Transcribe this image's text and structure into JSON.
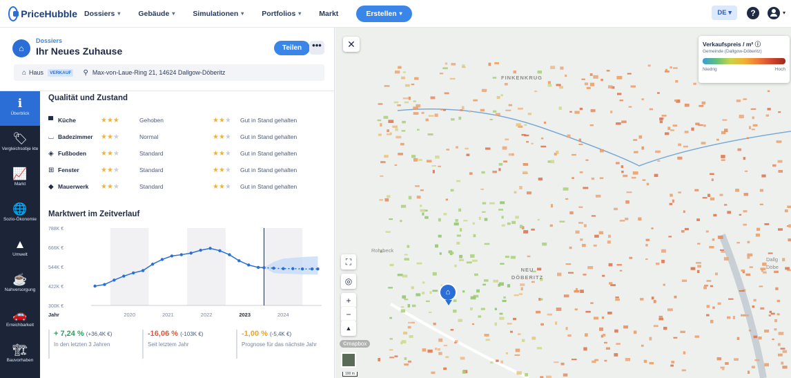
{
  "topbar": {
    "logo": "PriceHubble",
    "nav": [
      {
        "label": "Dossiers",
        "caret": true
      },
      {
        "label": "Gebäude",
        "caret": true
      },
      {
        "label": "Simulationen",
        "caret": true
      },
      {
        "label": "Portfolios",
        "caret": true
      },
      {
        "label": "Markt",
        "caret": false
      }
    ],
    "create_label": "Erstellen",
    "language": "DE",
    "help": "?"
  },
  "header": {
    "breadcrumb": "Dossiers",
    "title": "Ihr Neues Zuhause",
    "share_label": "Teilen",
    "more_label": "•••",
    "property_type": "Haus",
    "tag": "VERKAUF",
    "address": "Max-von-Laue-Ring 21, 14624 Dallgow-Döberitz"
  },
  "sidebar": {
    "items": [
      {
        "label": "Überblick",
        "icon": "info-icon",
        "glyph": "ℹ",
        "active": true
      },
      {
        "label": "Vergleichsobje kte",
        "icon": "tag-icon",
        "glyph": "🏷",
        "active": false
      },
      {
        "label": "Markt",
        "icon": "market-chart-icon",
        "glyph": "📈",
        "active": false
      },
      {
        "label": "Sozio-Ökonomie",
        "icon": "globe-icon",
        "glyph": "🌐",
        "active": false
      },
      {
        "label": "Umwelt",
        "icon": "mountain-icon",
        "glyph": "▲",
        "active": false
      },
      {
        "label": "Nahversorgung",
        "icon": "cup-icon",
        "glyph": "☕",
        "active": false
      },
      {
        "label": "Erreichbarkeit",
        "icon": "car-icon",
        "glyph": "🚗",
        "active": false
      },
      {
        "label": "Bauvorhaben",
        "icon": "crane-icon",
        "glyph": "🏗",
        "active": false
      }
    ]
  },
  "quality": {
    "title": "Qualität und Zustand",
    "rows": [
      {
        "name": "Küche",
        "icon": "kitchen-icon",
        "glyph": "▀",
        "rating": 3,
        "value": "Gehoben",
        "cond_rating": 2,
        "condition": "Gut in Stand gehalten"
      },
      {
        "name": "Badezimmer",
        "icon": "bathtub-icon",
        "glyph": "⌴",
        "rating": 2,
        "value": "Normal",
        "cond_rating": 2,
        "condition": "Gut in Stand gehalten"
      },
      {
        "name": "Fußboden",
        "icon": "floor-icon",
        "glyph": "◈",
        "rating": 2,
        "value": "Standard",
        "cond_rating": 2,
        "condition": "Gut in Stand gehalten"
      },
      {
        "name": "Fenster",
        "icon": "window-icon",
        "glyph": "⊞",
        "rating": 2,
        "value": "Standard",
        "cond_rating": 2,
        "condition": "Gut in Stand gehalten"
      },
      {
        "name": "Mauerwerk",
        "icon": "wall-icon",
        "glyph": "◆",
        "rating": 2,
        "value": "Standard",
        "cond_rating": 2,
        "condition": "Gut in Stand gehalten"
      }
    ]
  },
  "market_value": {
    "title": "Marktwert im Zeitverlauf"
  },
  "chart_data": {
    "type": "line",
    "title": "Marktwert im Zeitverlauf",
    "xlabel": "Jahr",
    "ylabel": "",
    "x_ticks": [
      "2020",
      "2021",
      "2022",
      "2023",
      "2024"
    ],
    "y_ticks": [
      "788K €",
      "666K €",
      "544K €",
      "422K €",
      "300K €"
    ],
    "ylim": [
      300,
      788
    ],
    "xlim": [
      2019.0,
      2025.0
    ],
    "series": [
      {
        "kind": "historical",
        "x": [
          2019.1,
          2019.35,
          2019.6,
          2019.85,
          2020.1,
          2020.35,
          2020.6,
          2020.85,
          2021.1,
          2021.35,
          2021.6,
          2021.85,
          2022.1,
          2022.35,
          2022.6,
          2022.85,
          2023.1,
          2023.35,
          2023.5
        ],
        "values": [
          422,
          432,
          460,
          485,
          505,
          520,
          560,
          590,
          612,
          620,
          630,
          648,
          660,
          645,
          620,
          582,
          555,
          540,
          538
        ]
      },
      {
        "kind": "forecast",
        "x": [
          2023.5,
          2023.75,
          2024.0,
          2024.25,
          2024.5,
          2024.75,
          2024.9
        ],
        "values": [
          538,
          535,
          532,
          532,
          530,
          530,
          530
        ],
        "band_upper": [
          538,
          575,
          595,
          600,
          605,
          608,
          610
        ],
        "band_lower": [
          538,
          505,
          500,
          498,
          496,
          495,
          494
        ]
      }
    ],
    "shaded_years": [
      "2020",
      "2022",
      "2024"
    ],
    "grid": false
  },
  "metrics": [
    {
      "value": "+ 7,24 %",
      "delta": "(+36,4K €)",
      "sub": "In den letzten 3 Jahren",
      "color": "#2aa35a"
    },
    {
      "value": "-16,06 %",
      "delta": "(-103K €)",
      "sub": "Seit letztem Jahr",
      "color": "#e0553a"
    },
    {
      "value": "-1,00 %",
      "delta": "(-5,4K €)",
      "sub": "Prognose für das nächste Jahr",
      "color": "#f0a323"
    }
  ],
  "map": {
    "close": "✕",
    "legend_title": "Verkaufspreis / m²",
    "legend_info": "ⓘ",
    "legend_sub": "Gemeinde (Dallgow-Döberitz)",
    "legend_low": "Niedrig",
    "legend_high": "Hoch",
    "labels": [
      "FINKENKRUG",
      "NEU DÖBERITZ",
      "Rohrbeck",
      "Dallg Döbe"
    ],
    "mapbox": "©mapbox",
    "scale": "100 m",
    "controls": {
      "fullscreen": "⛶",
      "locate": "◎",
      "zoom_in": "+",
      "zoom_out": "−",
      "compass": "▲"
    }
  }
}
